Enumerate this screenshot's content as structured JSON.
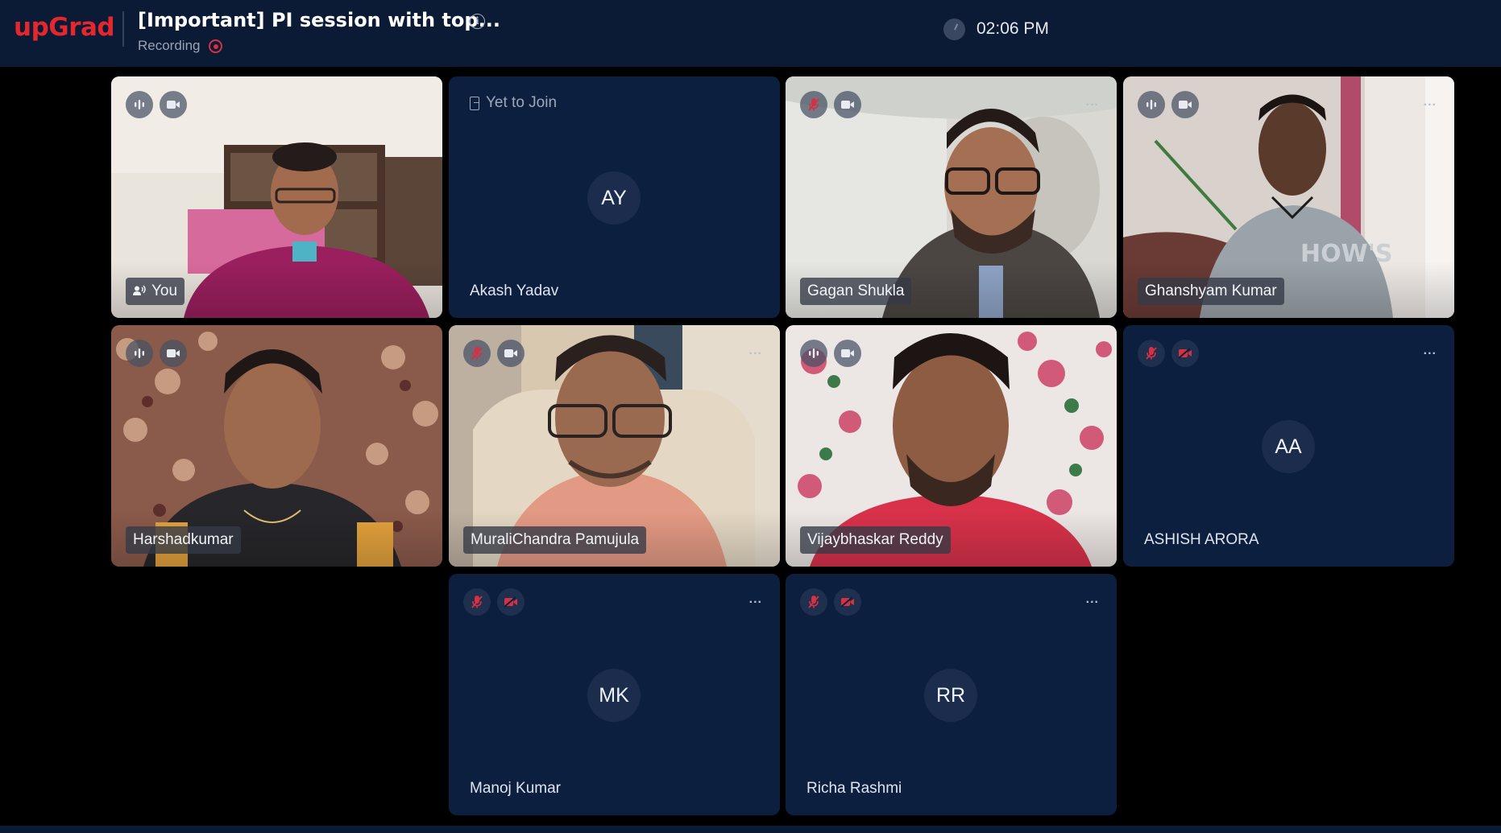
{
  "header": {
    "logo": "upGrad",
    "title": "[Important] PI session with top...",
    "recording_label": "Recording",
    "time": "02:06 PM"
  },
  "tiles": [
    {
      "name": "You",
      "video": true,
      "mic": "active-speaking",
      "camera": "on"
    },
    {
      "name": "Akash Yadav",
      "status": "Yet to Join",
      "initials": "AY",
      "video": false
    },
    {
      "name": "Gagan Shukla",
      "video": true,
      "mic": "muted",
      "camera": "on",
      "more": "..."
    },
    {
      "name": "Ghanshyam Kumar",
      "video": true,
      "mic": "active-speaking",
      "camera": "on",
      "more": "..."
    },
    {
      "name": "Harshadkumar",
      "video": true,
      "mic": "active-speaking",
      "camera": "on"
    },
    {
      "name": "MuraliChandra Pamujula",
      "video": true,
      "mic": "muted",
      "camera": "on",
      "more": "..."
    },
    {
      "name": "Vijaybhaskar Reddy",
      "video": true,
      "mic": "active-speaking",
      "camera": "on"
    },
    {
      "name": "ASHISH ARORA",
      "initials": "AA",
      "video": false,
      "mic": "muted",
      "camera": "off",
      "more": "..."
    },
    {
      "name": "Manoj Kumar",
      "initials": "MK",
      "video": false,
      "mic": "muted",
      "camera": "off",
      "more": "..."
    },
    {
      "name": "Richa Rashmi",
      "initials": "RR",
      "video": false,
      "mic": "muted",
      "camera": "off",
      "more": "..."
    }
  ],
  "colors": {
    "brand": "#e3272e",
    "topbar": "#0b1b36",
    "tile_bg": "#0c1f3f",
    "muted_icon": "#d63043",
    "recording": "#d63043"
  },
  "icons": [
    "info-icon",
    "recording-dot-icon",
    "clock-icon",
    "mic-icon",
    "mic-muted-icon",
    "camera-icon",
    "camera-off-icon",
    "more-options-icon",
    "join-door-icon",
    "speaker-icon"
  ]
}
